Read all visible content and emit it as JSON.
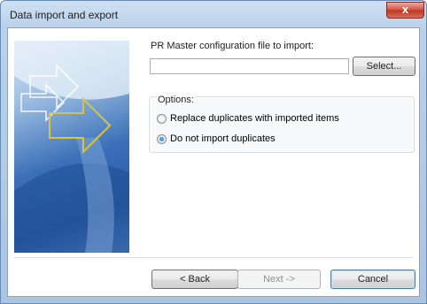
{
  "window": {
    "title": "Data import and export",
    "close_label": "x"
  },
  "file": {
    "label": "PR Master configuration file to import:",
    "value": "",
    "select_label": "Select..."
  },
  "options": {
    "legend": "Options:",
    "items": [
      {
        "label": "Replace duplicates with imported items",
        "checked": false
      },
      {
        "label": "Do not import duplicates",
        "checked": true
      }
    ]
  },
  "footer": {
    "back_label": "< Back",
    "next_label": "Next ->",
    "cancel_label": "Cancel"
  },
  "colors": {
    "accent": "#3b70b8",
    "title_bar": "#b9d1ea",
    "close": "#c2351f"
  },
  "icons": {
    "banner": "wizard-arrow-graphic"
  }
}
